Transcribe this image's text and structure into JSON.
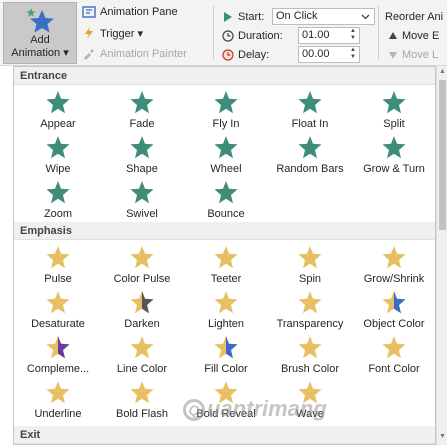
{
  "ribbon": {
    "add_animation": "Add\nAnimation ▾",
    "add_animation_line1": "Add",
    "add_animation_line2": "Animation ▾",
    "animation_pane": "Animation Pane",
    "trigger": "Trigger ▾",
    "animation_painter": "Animation Painter",
    "start_label": "Start:",
    "start_value": "On Click",
    "duration_label": "Duration:",
    "duration_value": "01.00",
    "delay_label": "Delay:",
    "delay_value": "00.00",
    "reorder_label": "Reorder Ani",
    "move_earlier": "Move E",
    "move_later": "Move L"
  },
  "sections": {
    "entrance": "Entrance",
    "emphasis": "Emphasis",
    "exit": "Exit"
  },
  "entrance_items": [
    "Appear",
    "Fade",
    "Fly In",
    "Float In",
    "Split",
    "Wipe",
    "Shape",
    "Wheel",
    "Random Bars",
    "Grow & Turn",
    "Zoom",
    "Swivel",
    "Bounce"
  ],
  "emphasis_items": [
    "Pulse",
    "Color Pulse",
    "Teeter",
    "Spin",
    "Grow/Shrink",
    "Desaturate",
    "Darken",
    "Lighten",
    "Transparency",
    "Object Color",
    "Compleme...",
    "Line Color",
    "Fill Color",
    "Brush Color",
    "Font Color",
    "Underline",
    "Bold Flash",
    "Bold Reveal",
    "Wave"
  ],
  "watermark": "uantrimang",
  "colors": {
    "entrance_star": "#3f8c7a",
    "emphasis_star": "#e8c063",
    "accent_purple": "#6a3aa0",
    "accent_blue": "#3a6bc8",
    "accent_red": "#c0392b"
  }
}
